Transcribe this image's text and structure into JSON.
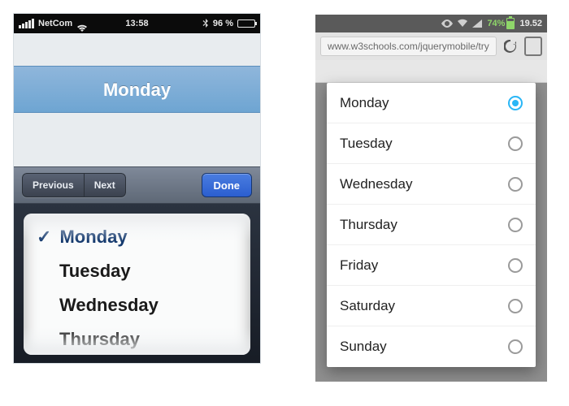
{
  "ios": {
    "status": {
      "carrier": "NetCom",
      "time": "13:58",
      "battery_pct": "96 %"
    },
    "selected_display": "Monday",
    "accessory": {
      "prev": "Previous",
      "next": "Next",
      "done": "Done"
    },
    "picker": {
      "items": [
        "Monday",
        "Tuesday",
        "Wednesday",
        "Thursday"
      ],
      "selected_index": 0
    }
  },
  "android": {
    "status": {
      "battery_pct": "74%",
      "time": "19.52"
    },
    "urlbar": "www.w3schools.com/jquerymobile/try",
    "dialog": {
      "items": [
        "Monday",
        "Tuesday",
        "Wednesday",
        "Thursday",
        "Friday",
        "Saturday",
        "Sunday"
      ],
      "selected_index": 0
    }
  }
}
